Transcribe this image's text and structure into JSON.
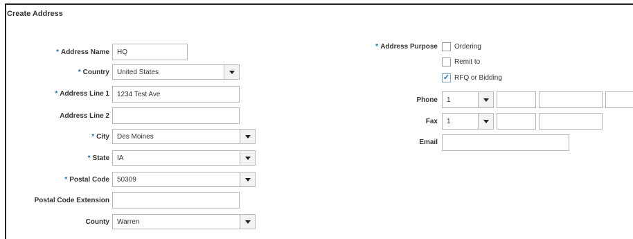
{
  "title": "Create Address",
  "form": {
    "address_name": {
      "label": "Address Name",
      "required": "*",
      "value": "HQ"
    },
    "country": {
      "label": "Country",
      "required": "*",
      "value": "United States"
    },
    "address_line1": {
      "label": "Address Line 1",
      "required": "*",
      "value": "1234 Test Ave"
    },
    "address_line2": {
      "label": "Address Line 2",
      "value": ""
    },
    "city": {
      "label": "City",
      "required": "*",
      "value": "Des Moines"
    },
    "state": {
      "label": "State",
      "required": "*",
      "value": "IA"
    },
    "postal_code": {
      "label": "Postal Code",
      "required": "*",
      "value": "50309"
    },
    "postal_code_extension": {
      "label": "Postal Code Extension",
      "value": ""
    },
    "county": {
      "label": "County",
      "value": "Warren"
    }
  },
  "purpose": {
    "label": "Address Purpose",
    "required": "*",
    "options": [
      {
        "label": "Ordering",
        "checked": false
      },
      {
        "label": "Remit to",
        "checked": false
      },
      {
        "label": "RFQ or Bidding",
        "checked": true
      }
    ]
  },
  "contact": {
    "phone": {
      "label": "Phone",
      "country_code": "1",
      "area": "",
      "number": "",
      "ext": ""
    },
    "fax": {
      "label": "Fax",
      "country_code": "1",
      "area": "",
      "number": ""
    },
    "email": {
      "label": "Email",
      "value": ""
    }
  },
  "icons": {
    "dropdown": "dropdown-arrow-icon",
    "check": "checkmark-icon"
  },
  "colors": {
    "required": "#1a73b8",
    "check": "#1b6fc2"
  }
}
